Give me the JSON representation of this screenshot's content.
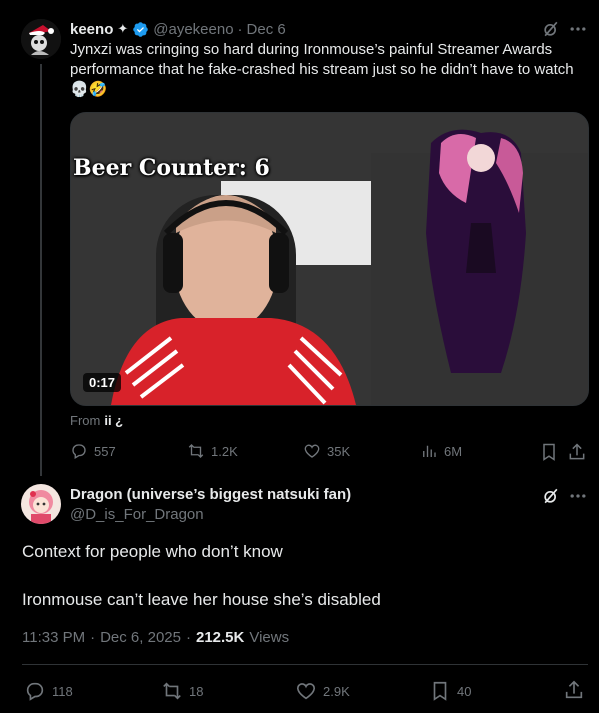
{
  "tweet1": {
    "name": "keeno",
    "sparkle": "✦",
    "handle": "@ayekeeno",
    "dot": "·",
    "date": "Dec 6",
    "text": "Jynxzi was cringing so hard during Ironmouse’s painful Streamer Awards performance that he fake-crashed his stream just so he didn’t have to watch 💀🤣",
    "media": {
      "overlay_text": "Beer Counter: 6",
      "duration": "0:17"
    },
    "from_label": "From",
    "from_source": "ii ¿",
    "actions": {
      "replies": "557",
      "reposts": "1.2K",
      "likes": "35K",
      "views": "6M"
    }
  },
  "tweet2": {
    "name": "Dragon (universe’s biggest natsuki fan)",
    "handle": "@D_is_For_Dragon",
    "line1": "Context for people who don’t know",
    "line2": "Ironmouse can’t leave her house she’s disabled",
    "time": "11:33 PM",
    "sep1": "·",
    "date": "Dec 6, 2025",
    "sep2": "·",
    "views_count": "212.5K",
    "views_label": "Views",
    "actions": {
      "replies": "118",
      "reposts": "18",
      "likes": "2.9K",
      "bookmarks": "40"
    }
  },
  "colors": {
    "background": "#000000",
    "text": "#e7e9ea",
    "muted": "#71767b",
    "verified": "#1d9bf0",
    "divider": "#2f3336"
  },
  "icons": [
    "grok-icon",
    "more-icon",
    "verified-badge-icon",
    "reply-icon",
    "repost-icon",
    "like-icon",
    "views-icon",
    "bookmark-icon",
    "share-icon"
  ]
}
